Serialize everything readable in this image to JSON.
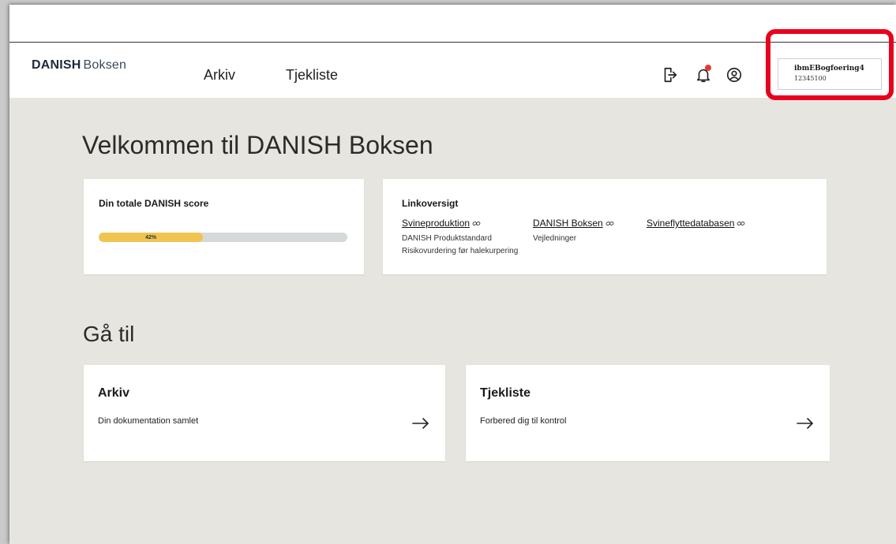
{
  "header": {
    "brand": "DANISH",
    "product": "Boksen",
    "nav": [
      {
        "label": "Arkiv"
      },
      {
        "label": "Tjekliste"
      }
    ],
    "icons": [
      "logout-icon",
      "bell-icon",
      "user-icon"
    ],
    "notification_dot_color": "#e63a2e",
    "account": {
      "name": "ibmEBogfoering4",
      "id": "12345100"
    },
    "highlight_color": "#e8001c"
  },
  "main": {
    "welcome_title": "Velkommen til DANISH Boksen",
    "score_card": {
      "title": "Din totale DANISH score",
      "progress_percent": 42,
      "progress_label": "42%",
      "progress_color": "#f0c451"
    },
    "links_card": {
      "title": "Linkoversigt",
      "columns": [
        {
          "main": "Svineproduktion",
          "subs": [
            "DANISH Produktstandard",
            "Risikovurdering før halekurpering"
          ]
        },
        {
          "main": "DANISH Boksen",
          "subs": [
            "Vejledninger"
          ]
        },
        {
          "main": "Svineflyttedatabasen",
          "subs": []
        }
      ]
    },
    "goto_title": "Gå til",
    "nav_cards": [
      {
        "title": "Arkiv",
        "description": "Din dokumentation samlet"
      },
      {
        "title": "Tjekliste",
        "description": "Forbered dig til kontrol"
      }
    ]
  },
  "colors": {
    "background": "#e6e5df",
    "card": "#ffffff"
  }
}
